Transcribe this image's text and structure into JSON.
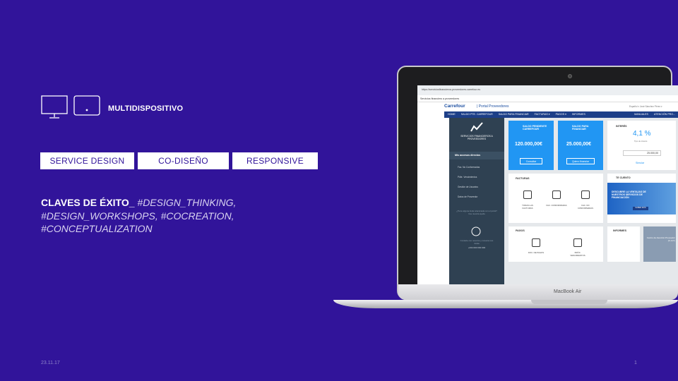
{
  "heading": "MULTIDISPOSITIVO",
  "tags": [
    "SERVICE DESIGN",
    "CO-DISEÑO",
    "RESPONSIVE"
  ],
  "claves": {
    "lead": "CLAVES DE ÉXITO_",
    "line1": " #DESIGN_THINKING,",
    "line2": "#DESIGN_WORKSHOPS, #COCREATION,",
    "line3": "#CONCEPTUALIZATION"
  },
  "footer": {
    "date": "23.11.17",
    "page": "1"
  },
  "laptop": {
    "brand": "MacBook Air",
    "url": "https://serviciosfinancieros.proveedores.carrefour.es",
    "tab": "Servicios financiero a proveedores",
    "logo": "Carrefour",
    "portal": "| Portal Proveedores",
    "user": "Español ▾   José Sánchez Pérez ▾",
    "nav": [
      "HOME",
      "SALDO PTE. CARREFOUR",
      "SALDO PARA FINANCIAR",
      "FACTURAS ▾",
      "PAGOS ▾",
      "INFORMES",
      "MANUALES",
      "ATENCIÓN PRO..."
    ],
    "sidebar": {
      "title": "SERVICIOS FINANCIEROS A PROVEEDORES",
      "section": "Mis accesos directos",
      "items": [
        "Fac. No Conformadas",
        "Pdte. Vencimientos",
        "Gestión de Usuarios",
        "Datos de Proveedor"
      ],
      "help": "¿Tiene alguna duda relacionada con el portal? Use nuestra ayuda",
      "phone_text": "Contacte con nosotros y resuelva sus dudas",
      "phone": "+034 000 000 000"
    },
    "cards": {
      "saldo_pendiente": {
        "label": "SALDO PENDIENTE CARREFOUR",
        "value": "120.000,00€",
        "button": "Consultar"
      },
      "saldo_financiar": {
        "label": "SALDO PARA FINANCIAR",
        "value": "25.000,00€",
        "button": "Quiero financiar"
      },
      "interes": {
        "label": "INTERÉS",
        "value": "4,1 %",
        "sub": "Tipo de interés",
        "amount": "25.000,00",
        "button": "Simular"
      },
      "facturas": {
        "label": "FACTURAS",
        "items": [
          "TODAS LAS FACTURAS",
          "FAC. CONFORMADAS",
          "FAC. NO CONFORMADAS"
        ]
      },
      "te_cuento": {
        "label": "TE CUENTO",
        "banner": "DESCUBRE LA VENTAJAS DE NUESTROS SERVICIOS DE FINANCIACIÓN",
        "button": "SABER MÁS"
      },
      "pagos": {
        "label": "PAGOS",
        "items": [
          "DOC. DE PAGOS",
          "PRÓX. VENCIMIENTOS"
        ]
      },
      "informes": {
        "label": "INFORMES"
      },
      "atencion": {
        "label": "Centro de Atención Proveedor (C.A.P.)"
      }
    }
  }
}
